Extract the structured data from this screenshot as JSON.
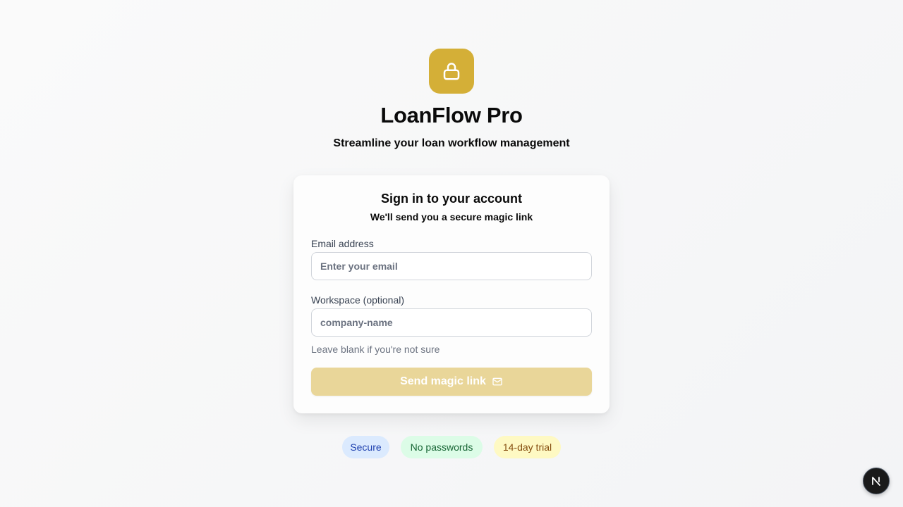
{
  "app": {
    "name": "LoanFlow Pro",
    "tagline": "Streamline your loan workflow management",
    "logo_icon": "lock-icon",
    "accent_color": "#d4af37"
  },
  "card": {
    "title": "Sign in to your account",
    "subtitle": "We'll send you a secure magic link",
    "email": {
      "label": "Email address",
      "value": "",
      "placeholder": "Enter your email"
    },
    "workspace": {
      "label": "Workspace (optional)",
      "value": "",
      "placeholder": "company-name",
      "hint": "Leave blank if you're not sure"
    },
    "submit": {
      "label": "Send magic link",
      "icon": "mail-icon",
      "disabled": true
    }
  },
  "badges": [
    {
      "label": "Secure",
      "color": "#1e40af"
    },
    {
      "label": "No passwords",
      "color": "#166534"
    },
    {
      "label": "14-day trial",
      "color": "#854d0e"
    }
  ],
  "dev_tools": {
    "label": "N",
    "icon": "nextjs-icon"
  }
}
